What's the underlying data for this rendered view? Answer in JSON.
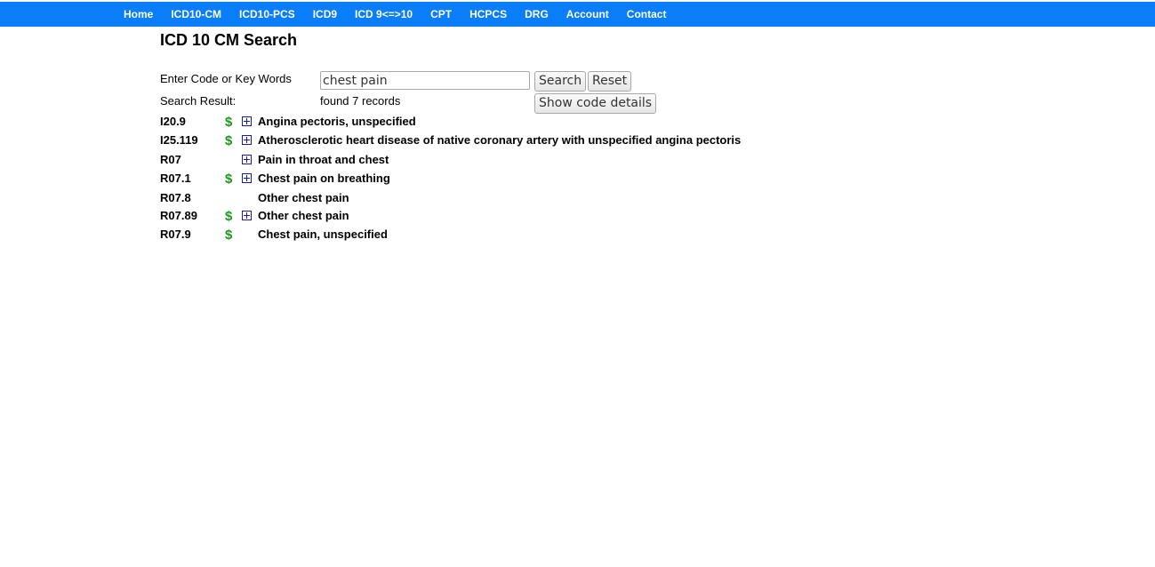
{
  "nav": {
    "items": [
      "Home",
      "ICD10-CM",
      "ICD10-PCS",
      "ICD9",
      "ICD 9<=>10",
      "CPT",
      "HCPCS",
      "DRG",
      "Account",
      "Contact"
    ]
  },
  "page": {
    "title": "ICD 10 CM Search"
  },
  "search": {
    "label": "Enter Code or Key Words",
    "value": "chest pain",
    "search_button": "Search",
    "reset_button": "Reset",
    "details_button": "Show code details",
    "result_label": "Search Result:",
    "result_count": "found 7 records"
  },
  "results": [
    {
      "code": "I20.9",
      "dollar": "$",
      "expand": true,
      "desc": "Angina pectoris, unspecified"
    },
    {
      "code": "I25.119",
      "dollar": "$",
      "expand": true,
      "desc": "Atherosclerotic heart disease of native coronary artery with unspecified angina pectoris"
    },
    {
      "code": "R07",
      "dollar": "",
      "expand": true,
      "desc": "Pain in throat and chest"
    },
    {
      "code": "R07.1",
      "dollar": "$",
      "expand": true,
      "desc": "Chest pain on breathing"
    },
    {
      "code": "R07.8",
      "dollar": "",
      "expand": false,
      "desc": "Other chest pain"
    },
    {
      "code": "R07.89",
      "dollar": "$",
      "expand": true,
      "desc": "Other chest pain"
    },
    {
      "code": "R07.9",
      "dollar": "$",
      "expand": false,
      "desc": "Chest pain, unspecified"
    }
  ],
  "colors": {
    "nav_bg": "#0a7ef9",
    "dollar": "#1a9a1a",
    "expand_icon": "#1a1aa8"
  }
}
